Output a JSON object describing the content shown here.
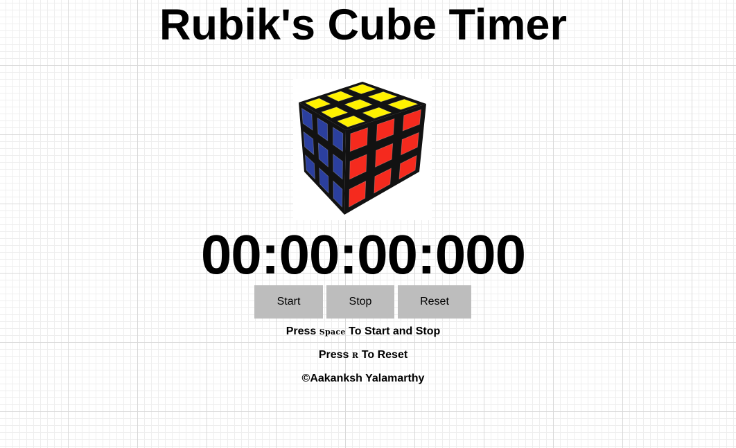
{
  "page": {
    "title": "Rubik's Cube Timer"
  },
  "cube_image": {
    "icon": "rubiks-cube-image",
    "colors": {
      "top": "#fff200",
      "left": "#2b3f9e",
      "right": "#f52a1e",
      "frame": "#121212"
    }
  },
  "timer": {
    "display": "00:00:00:000"
  },
  "controls": {
    "start_label": "Start",
    "stop_label": "Stop",
    "reset_label": "Reset",
    "button_color": "#bdbdbd"
  },
  "instructions": {
    "start_stop_prefix": "Press",
    "start_stop_key": "Space",
    "start_stop_suffix": "To Start and Stop",
    "reset_prefix": "Press",
    "reset_key": "R",
    "reset_suffix": "To Reset"
  },
  "footer": {
    "credit": "©Aakanksh Yalamarthy"
  }
}
